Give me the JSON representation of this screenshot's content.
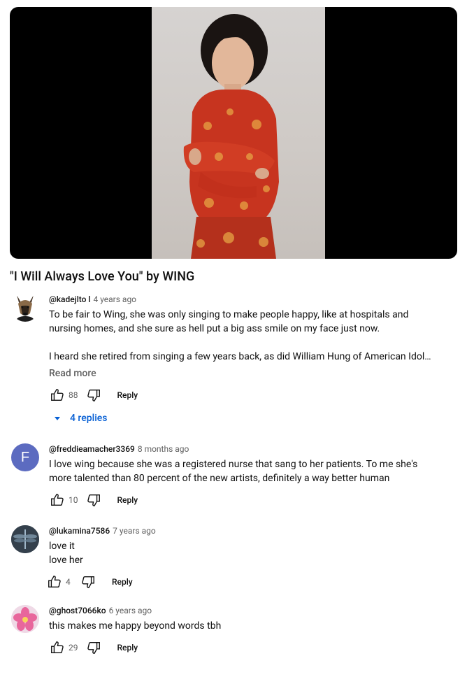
{
  "video": {
    "title": "\"I Will Always Love You\" by WING"
  },
  "comments": [
    {
      "author": "@kadejlto l",
      "time": "4 years ago",
      "text": "To be fair to Wing, she was only singing to make people happy, like at hospitals and\nnursing homes, and she sure as hell put a big ass smile on my face just now.\n\nI heard she retired from singing a few years back, as did William Hung of American Idol…",
      "read_more": "Read more",
      "likes": "88",
      "reply_label": "Reply",
      "replies_label": "4 replies",
      "avatar": "dog-avatar"
    },
    {
      "author": "@freddieamacher3369",
      "time": "8 months ago",
      "text": "I love wing because she was a registered nurse that sang to her patients. To me she's\nmore talented than 80 percent of the new artists, definitely a way better human",
      "likes": "10",
      "reply_label": "Reply",
      "avatar_letter": "F",
      "avatar_color": "#5c6bc0"
    },
    {
      "author": "@lukamina7586",
      "time": "7 years ago",
      "text": "love it\nlove her",
      "likes": "4",
      "reply_label": "Reply",
      "avatar": "dragonfly-avatar"
    },
    {
      "author": "@ghost7066ko",
      "time": "6 years ago",
      "text": "this makes me happy beyond words tbh",
      "likes": "29",
      "reply_label": "Reply",
      "avatar": "flower-avatar"
    }
  ]
}
